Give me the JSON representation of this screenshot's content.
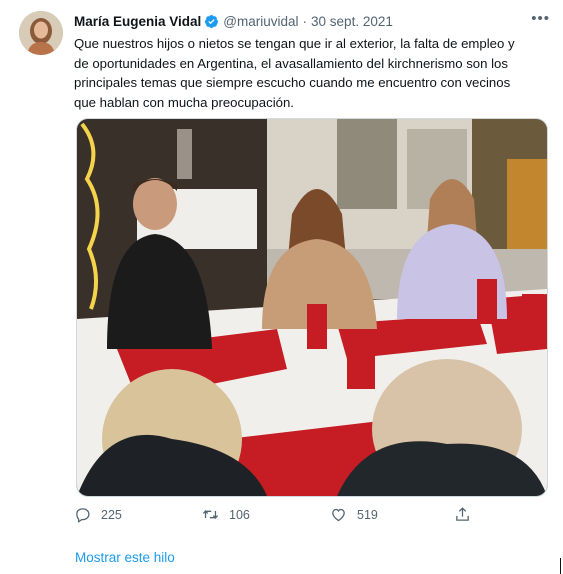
{
  "author": {
    "name": "María Eugenia Vidal",
    "handle": "@mariuvidal",
    "separator": "·",
    "date": "30 sept. 2021",
    "verified_color": "#1d9bf0"
  },
  "tweet": {
    "text": "Que nuestros hijos o nietos se tengan que ir al exterior, la falta de empleo y\nde oportunidades en Argentina, el avasallamiento del kirchnerismo son los\nprincipales temas que siempre escucho cuando me encuentro con vecinos\nque hablan con mucha preocupación."
  },
  "icons": {
    "more": "more-dots-icon",
    "reply": "reply-icon",
    "retweet": "retweet-icon",
    "like": "heart-icon",
    "share": "share-icon",
    "verified": "verified-badge-icon"
  },
  "actions": {
    "more_label": "•••",
    "replies": "225",
    "retweets": "106",
    "likes": "519"
  },
  "thread": {
    "show_label": "Mostrar este hilo"
  },
  "colors": {
    "accent": "#1d9bf0",
    "secondary_text": "#536471"
  }
}
